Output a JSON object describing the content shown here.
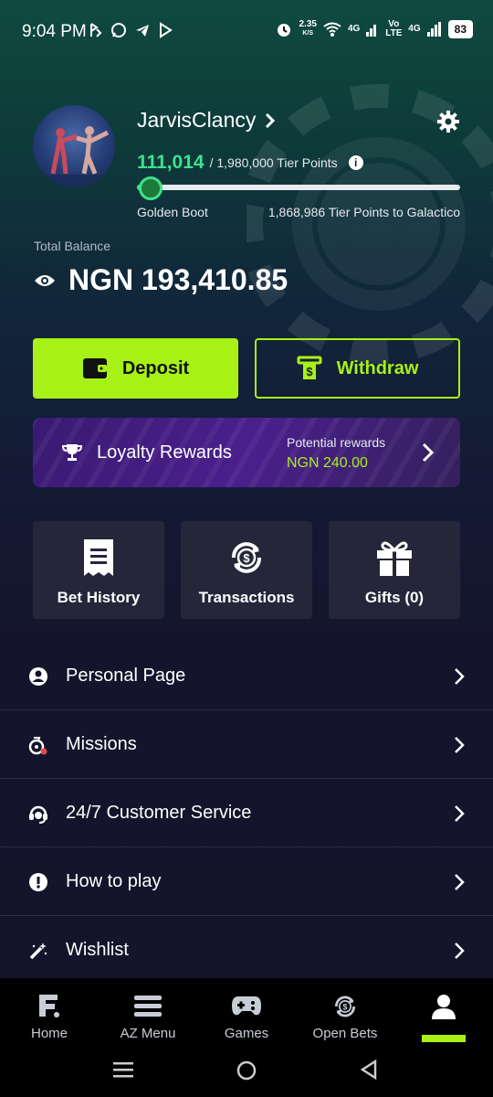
{
  "status_bar": {
    "time": "9:04 PM",
    "net_speed": "2.35",
    "net_unit": "K/S",
    "sim1": "4G",
    "volte": "Vo LTE",
    "sim2": "4G",
    "battery": "83"
  },
  "profile": {
    "username": "JarvisClancy",
    "points_current": "111,014",
    "points_total": "/ 1,980,000 Tier Points",
    "tier_current": "Golden Boot",
    "tier_next_text": "1,868,986 Tier Points to Galactico",
    "progress_fraction": 0.056
  },
  "balance": {
    "label": "Total Balance",
    "value": "NGN 193,410.85"
  },
  "actions": {
    "deposit": "Deposit",
    "withdraw": "Withdraw"
  },
  "loyalty": {
    "title": "Loyalty Rewards",
    "potential_label": "Potential rewards",
    "potential_value": "NGN 240.00"
  },
  "tiles": [
    {
      "label": "Bet History",
      "icon": "ticket-icon"
    },
    {
      "label": "Transactions",
      "icon": "money-cycle-icon"
    },
    {
      "label": "Gifts (0)",
      "icon": "gift-icon"
    }
  ],
  "menu": [
    {
      "label": "Personal Page",
      "icon": "user-circle-icon"
    },
    {
      "label": "Missions",
      "icon": "missions-icon"
    },
    {
      "label": "24/7 Customer Service",
      "icon": "headset-icon"
    },
    {
      "label": "How to play",
      "icon": "exclamation-icon"
    },
    {
      "label": "Wishlist",
      "icon": "magic-wand-icon"
    }
  ],
  "bottom_nav": [
    {
      "label": "Home",
      "icon": "logo-f-icon"
    },
    {
      "label": "AZ Menu",
      "icon": "hamburger-icon"
    },
    {
      "label": "Games",
      "icon": "gamepad-icon"
    },
    {
      "label": "Open Bets",
      "icon": "money-cycle-icon"
    },
    {
      "label": "",
      "icon": "profile-icon",
      "active": true
    }
  ],
  "colors": {
    "accent": "#a8f117",
    "points_green": "#3ee28a",
    "tile_bg": "#25263a",
    "loyalty_bg": "#4a1f8c"
  }
}
